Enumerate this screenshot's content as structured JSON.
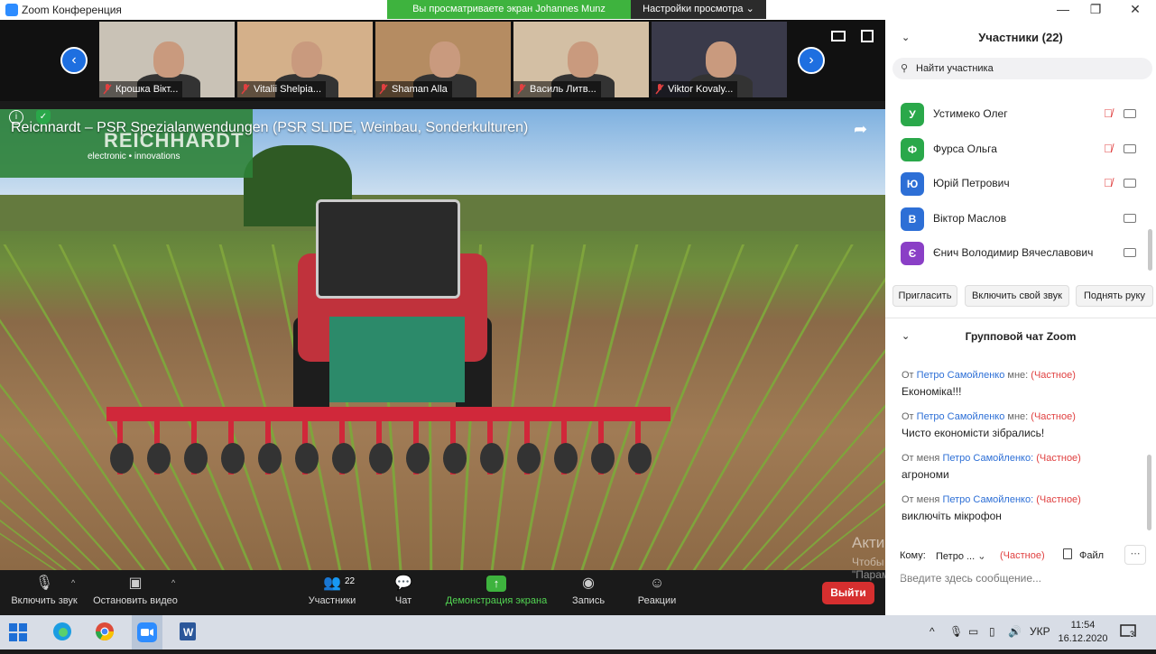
{
  "window": {
    "title": "Zoom Конференция",
    "share_banner": "Вы просматриваете экран Johannes Munz",
    "view_options": "Настройки просмотра"
  },
  "thumbnails": [
    {
      "name": "Крошка Вікт...",
      "bg": "#c9c2b6"
    },
    {
      "name": "Vitalii Shelpia...",
      "bg": "#d4b08a"
    },
    {
      "name": "Shaman Alla",
      "bg": "#b58c62"
    },
    {
      "name": "Василь Литв...",
      "bg": "#d3bfa4"
    },
    {
      "name": "Viktor Kovaly...",
      "bg": "#3a3a4a"
    }
  ],
  "video": {
    "title": "Reichnardt – PSR Spezialanwendungen (PSR SLIDE, Weinbau, Sonderkulturen)",
    "logo_main": "REICHHARDT",
    "logo_sub": "electronic • innovations"
  },
  "toolbar": {
    "mute": "Включить звук",
    "video": "Остановить видео",
    "participants": "Участники",
    "participants_count": "22",
    "chat": "Чат",
    "share": "Демонстрация экрана",
    "record": "Запись",
    "reactions": "Реакции",
    "leave": "Выйти"
  },
  "panel": {
    "title": "Участники (22)",
    "search_placeholder": "Найти участника",
    "participants": [
      {
        "initial": "У",
        "name": "Устимеко Олег",
        "color": "#2aa84a",
        "muted": true
      },
      {
        "initial": "Ф",
        "name": "Фурса Ольга",
        "color": "#2aa84a",
        "muted": true
      },
      {
        "initial": "Ю",
        "name": "Юрій Петрович",
        "color": "#2d6fd6",
        "muted": true
      },
      {
        "initial": "В",
        "name": "Віктор Маслов",
        "color": "#2d6fd6",
        "muted": false
      },
      {
        "initial": "Є",
        "name": "Єнич Володимир Вячеславович",
        "color": "#8a3fc6",
        "muted": false
      }
    ],
    "buttons": [
      "Пригласить",
      "Включить свой звук",
      "Поднять руку"
    ]
  },
  "chat": {
    "title": "Групповой чат Zoom",
    "messages": [
      {
        "prefix": "От",
        "who": "Петро Самойленко",
        "suffix": "мне:",
        "priv": "(Частное)",
        "text": "Економіка!!!"
      },
      {
        "prefix": "От",
        "who": "Петро Самойленко",
        "suffix": "мне:",
        "priv": "(Частное)",
        "text": "Чисто економісти зібрались!"
      },
      {
        "prefix": "От меня",
        "who": "Петро Самойленко:",
        "suffix": "",
        "priv": "(Частное)",
        "text": "агрономи"
      },
      {
        "prefix": "От меня",
        "who": "Петро Самойленко:",
        "suffix": "",
        "priv": "(Частное)",
        "text": "виключіть мікрофон"
      }
    ],
    "to_label": "Кому:",
    "to_value": "Петро ...",
    "to_priv": "(Частное)",
    "file": "Файл",
    "input_placeholder": "Введите здесь сообщение..."
  },
  "watermark": {
    "line1": "Активация Windows",
    "line2": "Чтобы активировать Windows, перейдите в раздел \"Параметры\"."
  },
  "taskbar": {
    "lang": "УКР",
    "time": "11:54",
    "date": "16.12.2020",
    "notif_count": "3"
  }
}
